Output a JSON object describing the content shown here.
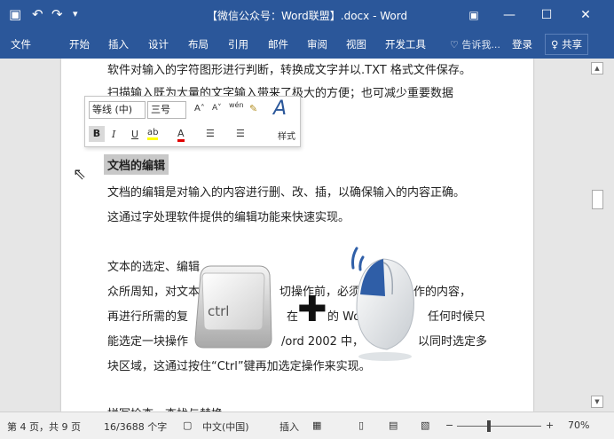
{
  "titlebar": {
    "title": "【微信公众号：Word联盟】.docx - Word",
    "save_icon": "▣",
    "undo_icon": "↶",
    "redo_icon": "↷",
    "customize_icon": "▾",
    "ribbon_display_icon": "▣",
    "minimize_icon": "—",
    "maximize_icon": "☐",
    "close_icon": "✕"
  },
  "ribbon": {
    "tabs": [
      "文件",
      "开始",
      "插入",
      "设计",
      "布局",
      "引用",
      "邮件",
      "审阅",
      "视图",
      "开发工具"
    ],
    "tell_me": "♡ 告诉我...",
    "login": "登录",
    "share": "♀ 共享"
  },
  "minitoolbar": {
    "font_name": "等线 (中)",
    "font_size": "三号",
    "grow_font": "A˄",
    "shrink_font": "A˅",
    "phonetic": "wén",
    "format_painter": "✎",
    "styles_icon": "A",
    "bold": "B",
    "italic": "I",
    "underline": "U",
    "highlight": "ab",
    "font_color": "A",
    "bullets": "☰",
    "numbering": "☰",
    "styles": "样式"
  },
  "document": {
    "lines": [
      "软件对输入的字符图形进行判断，转换成文字并以.TXT 格式文件保存。",
      "扫描输入既为大量的文字输入带来了极大的方便；也可减少重要数据",
      "文档的编辑",
      "文档的编辑是对输入的内容进行删、改、插，以确保输入的内容正确。",
      "这通过字处理软件提供的编辑功能来快速实现。",
      "文本的选定、编辑",
      "众所周知，对文本",
      "切操作前，必须",
      "作的内容，",
      "再进行所需的复",
      "在",
      "的 Wo",
      "任何时候只",
      "能选定一块操作",
      "/ord 2002 中，",
      "以同时选定多",
      "块区域，这通过按住“Ctrl”键再加选定操作来实现。",
      "拼写检查、查找与替换"
    ]
  },
  "overlay": {
    "ctrl_label": "ctrl",
    "plus": "✚",
    "cursor_icon": "⇖"
  },
  "statusbar": {
    "page": "第 4 页，共 9 页",
    "words": "16/3688 个字",
    "proof_icon": "▢",
    "language": "中文(中国)",
    "mode": "插入",
    "macro_icon": "▦",
    "read_icon": "▯",
    "print_icon": "▤",
    "web_icon": "▧",
    "zoom_out": "−",
    "zoom_in": "+",
    "zoom": "70%"
  },
  "colors": {
    "accent": "#2b579a",
    "selection": "#c8c8c8"
  }
}
